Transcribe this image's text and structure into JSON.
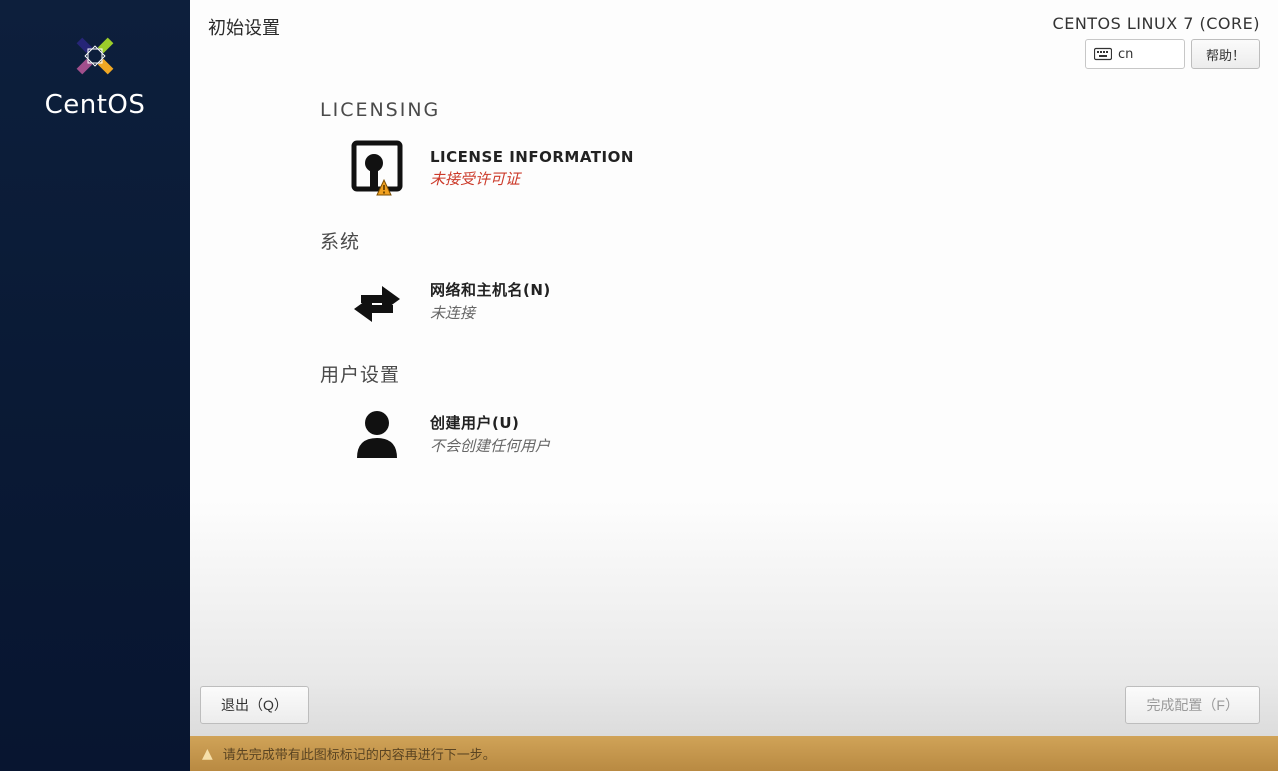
{
  "sidebar": {
    "brand": "CentOS"
  },
  "header": {
    "title": "初始设置",
    "distro": "CENTOS LINUX 7 (CORE)",
    "keyboard_layout": "cn",
    "help_label": "帮助！"
  },
  "sections": {
    "licensing": {
      "title": "LICENSING",
      "spoke": {
        "title": "LICENSE INFORMATION",
        "status": "未接受许可证",
        "warning": true
      }
    },
    "system": {
      "title": "系统",
      "spoke": {
        "title": "网络和主机名(N)",
        "status": "未连接"
      }
    },
    "user": {
      "title": "用户设置",
      "spoke": {
        "title": "创建用户(U)",
        "status": "不会创建任何用户"
      }
    }
  },
  "footer": {
    "quit_label": "退出（Q）",
    "finish_label": "完成配置（F）"
  },
  "warnbar": {
    "message": "请先完成带有此图标标记的内容再进行下一步。"
  }
}
